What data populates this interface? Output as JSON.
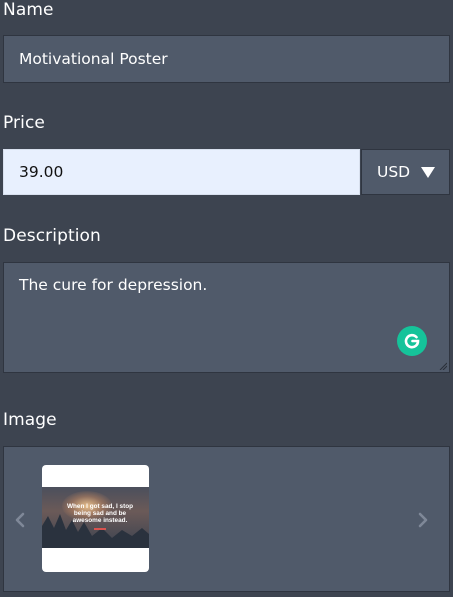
{
  "form": {
    "name": {
      "label": "Name",
      "value": "Motivational Poster"
    },
    "price": {
      "label": "Price",
      "value": "39.00",
      "currency": "USD"
    },
    "description": {
      "label": "Description",
      "value": "The cure for depression."
    },
    "image": {
      "label": "Image",
      "thumbnail_text": "When I got sad, I stop being sad and be awesome instead."
    }
  },
  "colors": {
    "background": "#3d4450",
    "field_bg": "#505a6a",
    "autofill_bg": "#e8f0fe",
    "grammarly_green": "#15c39a"
  },
  "icons": {
    "currency_caret": "caret-down-icon",
    "grammarly": "grammarly-icon",
    "prev": "chevron-left-icon",
    "next": "chevron-right-icon",
    "resize": "resize-handle-icon"
  }
}
